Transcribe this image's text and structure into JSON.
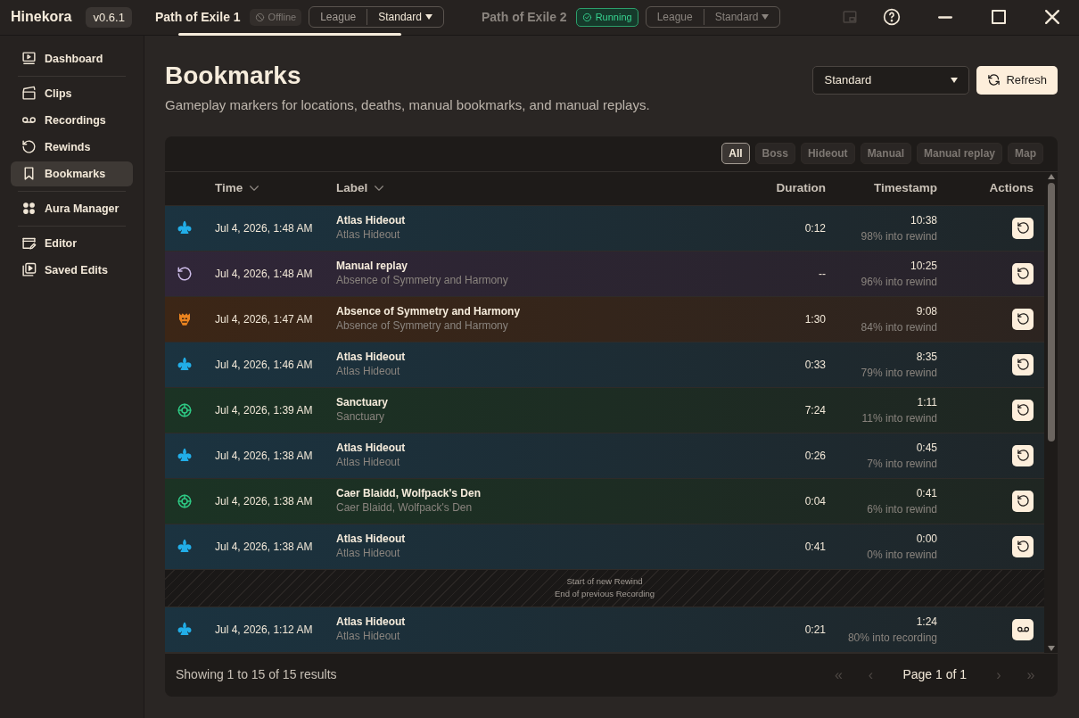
{
  "app": {
    "name": "Hinekora",
    "version": "v0.6.1"
  },
  "games": [
    {
      "name": "Path of Exile 1",
      "selected": true,
      "status": {
        "kind": "offline",
        "label": "Offline"
      },
      "league": {
        "label": "League",
        "value": "Standard"
      }
    },
    {
      "name": "Path of Exile 2",
      "selected": false,
      "status": {
        "kind": "running",
        "label": "Running"
      },
      "league": {
        "label": "League",
        "value": "Standard"
      }
    }
  ],
  "sidebar": {
    "groups": [
      {
        "items": [
          {
            "kind": "dashboard",
            "label": "Dashboard",
            "selected": false
          }
        ]
      },
      {
        "items": [
          {
            "kind": "clips",
            "label": "Clips",
            "selected": false
          },
          {
            "kind": "recordings",
            "label": "Recordings",
            "selected": false
          },
          {
            "kind": "rewinds",
            "label": "Rewinds",
            "selected": false
          },
          {
            "kind": "bookmarks",
            "label": "Bookmarks",
            "selected": true
          }
        ]
      },
      {
        "items": [
          {
            "kind": "aura",
            "label": "Aura Manager",
            "selected": false
          }
        ]
      },
      {
        "items": [
          {
            "kind": "editor",
            "label": "Editor",
            "selected": false
          },
          {
            "kind": "saved",
            "label": "Saved Edits",
            "selected": false
          }
        ]
      }
    ]
  },
  "page": {
    "title": "Bookmarks",
    "subtitle": "Gameplay markers for locations, deaths, manual bookmarks, and manual replays.",
    "league_select": "Standard",
    "refresh_button": "Refresh"
  },
  "filters": [
    {
      "label": "All",
      "selected": true
    },
    {
      "label": "Boss",
      "selected": false
    },
    {
      "label": "Hideout",
      "selected": false
    },
    {
      "label": "Manual",
      "selected": false
    },
    {
      "label": "Manual replay",
      "selected": false
    },
    {
      "label": "Map",
      "selected": false
    }
  ],
  "table": {
    "columns": [
      {
        "label": "Time",
        "sortable": true
      },
      {
        "label": "Label",
        "sortable": true
      },
      {
        "label": "Duration",
        "sortable": false
      },
      {
        "label": "Timestamp",
        "sortable": false
      },
      {
        "label": "Actions",
        "sortable": false
      }
    ],
    "rows": [
      {
        "kind": "hideout",
        "time": "Jul 4, 2026, 1:48 AM",
        "label": "Atlas Hideout",
        "sublabel": "Atlas Hideout",
        "duration": "0:12",
        "timestamp": "10:38",
        "position": "98% into rewind",
        "action": {
          "kind": "rewind"
        }
      },
      {
        "kind": "manual_replay",
        "time": "Jul 4, 2026, 1:48 AM",
        "label": "Manual replay",
        "sublabel": "Absence of Symmetry and Harmony",
        "duration": "--",
        "timestamp": "10:25",
        "position": "96% into rewind",
        "action": {
          "kind": "rewind"
        }
      },
      {
        "kind": "boss",
        "time": "Jul 4, 2026, 1:47 AM",
        "label": "Absence of Symmetry and Harmony",
        "sublabel": "Absence of Symmetry and Harmony",
        "duration": "1:30",
        "timestamp": "9:08",
        "position": "84% into rewind",
        "action": {
          "kind": "rewind"
        }
      },
      {
        "kind": "hideout",
        "time": "Jul 4, 2026, 1:46 AM",
        "label": "Atlas Hideout",
        "sublabel": "Atlas Hideout",
        "duration": "0:33",
        "timestamp": "8:35",
        "position": "79% into rewind",
        "action": {
          "kind": "rewind"
        }
      },
      {
        "kind": "map",
        "time": "Jul 4, 2026, 1:39 AM",
        "label": "Sanctuary",
        "sublabel": "Sanctuary",
        "duration": "7:24",
        "timestamp": "1:11",
        "position": "11% into rewind",
        "action": {
          "kind": "rewind"
        }
      },
      {
        "kind": "hideout",
        "time": "Jul 4, 2026, 1:38 AM",
        "label": "Atlas Hideout",
        "sublabel": "Atlas Hideout",
        "duration": "0:26",
        "timestamp": "0:45",
        "position": "7% into rewind",
        "action": {
          "kind": "rewind"
        }
      },
      {
        "kind": "map",
        "time": "Jul 4, 2026, 1:38 AM",
        "label": "Caer Blaidd, Wolfpack's Den",
        "sublabel": "Caer Blaidd, Wolfpack's Den",
        "duration": "0:04",
        "timestamp": "0:41",
        "position": "6% into rewind",
        "action": {
          "kind": "rewind"
        }
      },
      {
        "kind": "hideout",
        "time": "Jul 4, 2026, 1:38 AM",
        "label": "Atlas Hideout",
        "sublabel": "Atlas Hideout",
        "duration": "0:41",
        "timestamp": "0:00",
        "position": "0% into rewind",
        "action": {
          "kind": "rewind"
        }
      },
      {
        "kind": "separator",
        "lines": [
          "Start of new Rewind",
          "End of previous Recording"
        ]
      },
      {
        "kind": "hideout",
        "time": "Jul 4, 2026, 1:12 AM",
        "label": "Atlas Hideout",
        "sublabel": "Atlas Hideout",
        "duration": "0:21",
        "timestamp": "1:24",
        "position": "80% into recording",
        "action": {
          "kind": "recording"
        }
      }
    ]
  },
  "footer": {
    "summary": "Showing 1 to 15 of 15 results",
    "page": "Page 1 of 1",
    "nav": [
      {
        "glyph": "«",
        "disabled": true
      },
      {
        "glyph": "‹",
        "disabled": true
      },
      {
        "glyph": "›",
        "disabled": true
      },
      {
        "glyph": "»",
        "disabled": true
      }
    ]
  }
}
